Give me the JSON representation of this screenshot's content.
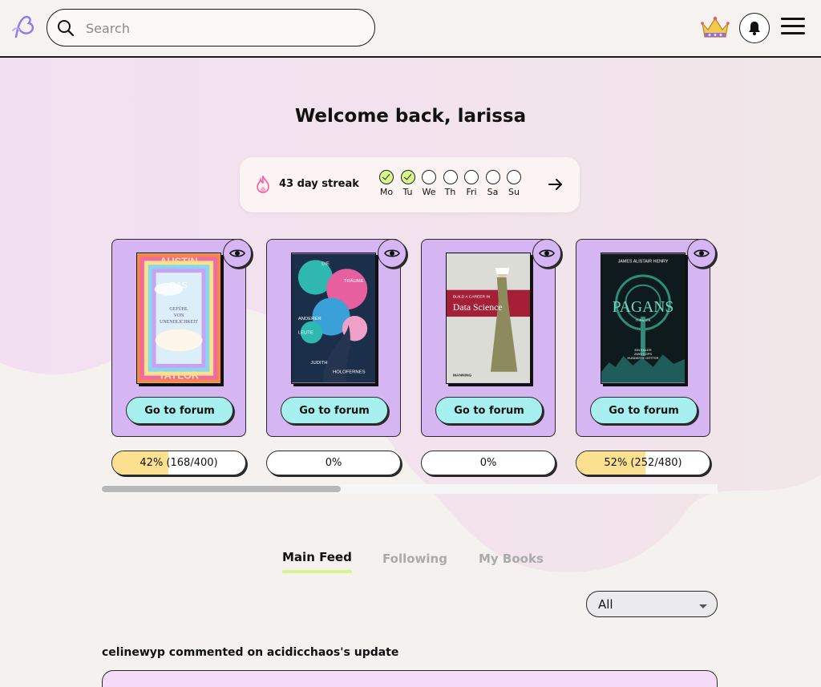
{
  "header": {
    "search_placeholder": "Search",
    "icons": [
      "logo-icon",
      "search-icon",
      "crown-icon",
      "bell-icon",
      "menu-icon"
    ]
  },
  "welcome": "Welcome back, larissa",
  "streak": {
    "label": "43 day streak",
    "days": [
      {
        "label": "Mo",
        "done": true
      },
      {
        "label": "Tu",
        "done": true
      },
      {
        "label": "We",
        "done": false
      },
      {
        "label": "Th",
        "done": false
      },
      {
        "label": "Fri",
        "done": false
      },
      {
        "label": "Sa",
        "done": false
      },
      {
        "label": "Su",
        "done": false
      }
    ]
  },
  "books": [
    {
      "cover_text": [
        "AUSTIN",
        "DAS",
        "GEFÜHL",
        "VON",
        "UNENDLICHKEIT",
        "TAYLOR"
      ],
      "forum_label": "Go to forum",
      "progress_label": "42% (168/400)",
      "progress": 0.42
    },
    {
      "cover_text": [
        "DIE",
        "TRÄUME",
        "ANDERER",
        "LEUTE",
        "JUDITH",
        "HOLOFERNES"
      ],
      "forum_label": "Go to forum",
      "progress_label": "0%",
      "progress": 0
    },
    {
      "cover_text": [
        "BUILD A CAREER IN",
        "Data Science",
        "MANNING"
      ],
      "forum_label": "Go to forum",
      "progress_label": "0%",
      "progress": 0
    },
    {
      "cover_text": [
        "JAMES ALISTAIR HENRY",
        "PAGANS",
        "THRILLER",
        "EIN KILLER",
        "ZWEI COPS",
        "HUNDERTE GÖTTER"
      ],
      "forum_label": "Go to forum",
      "progress_label": "52% (252/480)",
      "progress": 0.52
    }
  ],
  "carousel_scroll_position": 0.39,
  "tabs": [
    {
      "label": "Main Feed",
      "active": true
    },
    {
      "label": "Following",
      "active": false
    },
    {
      "label": "My Books",
      "active": false
    }
  ],
  "filter": {
    "selected": "All"
  },
  "feed": {
    "first_item_title": "celinewyp commented on acidicchaos's update"
  },
  "colors": {
    "lime": "#d8f58a",
    "lavender": "#d5b6f3",
    "cyan": "#a8f0f0",
    "progress": "#fbe08f",
    "pink": "#f4dcf8"
  }
}
